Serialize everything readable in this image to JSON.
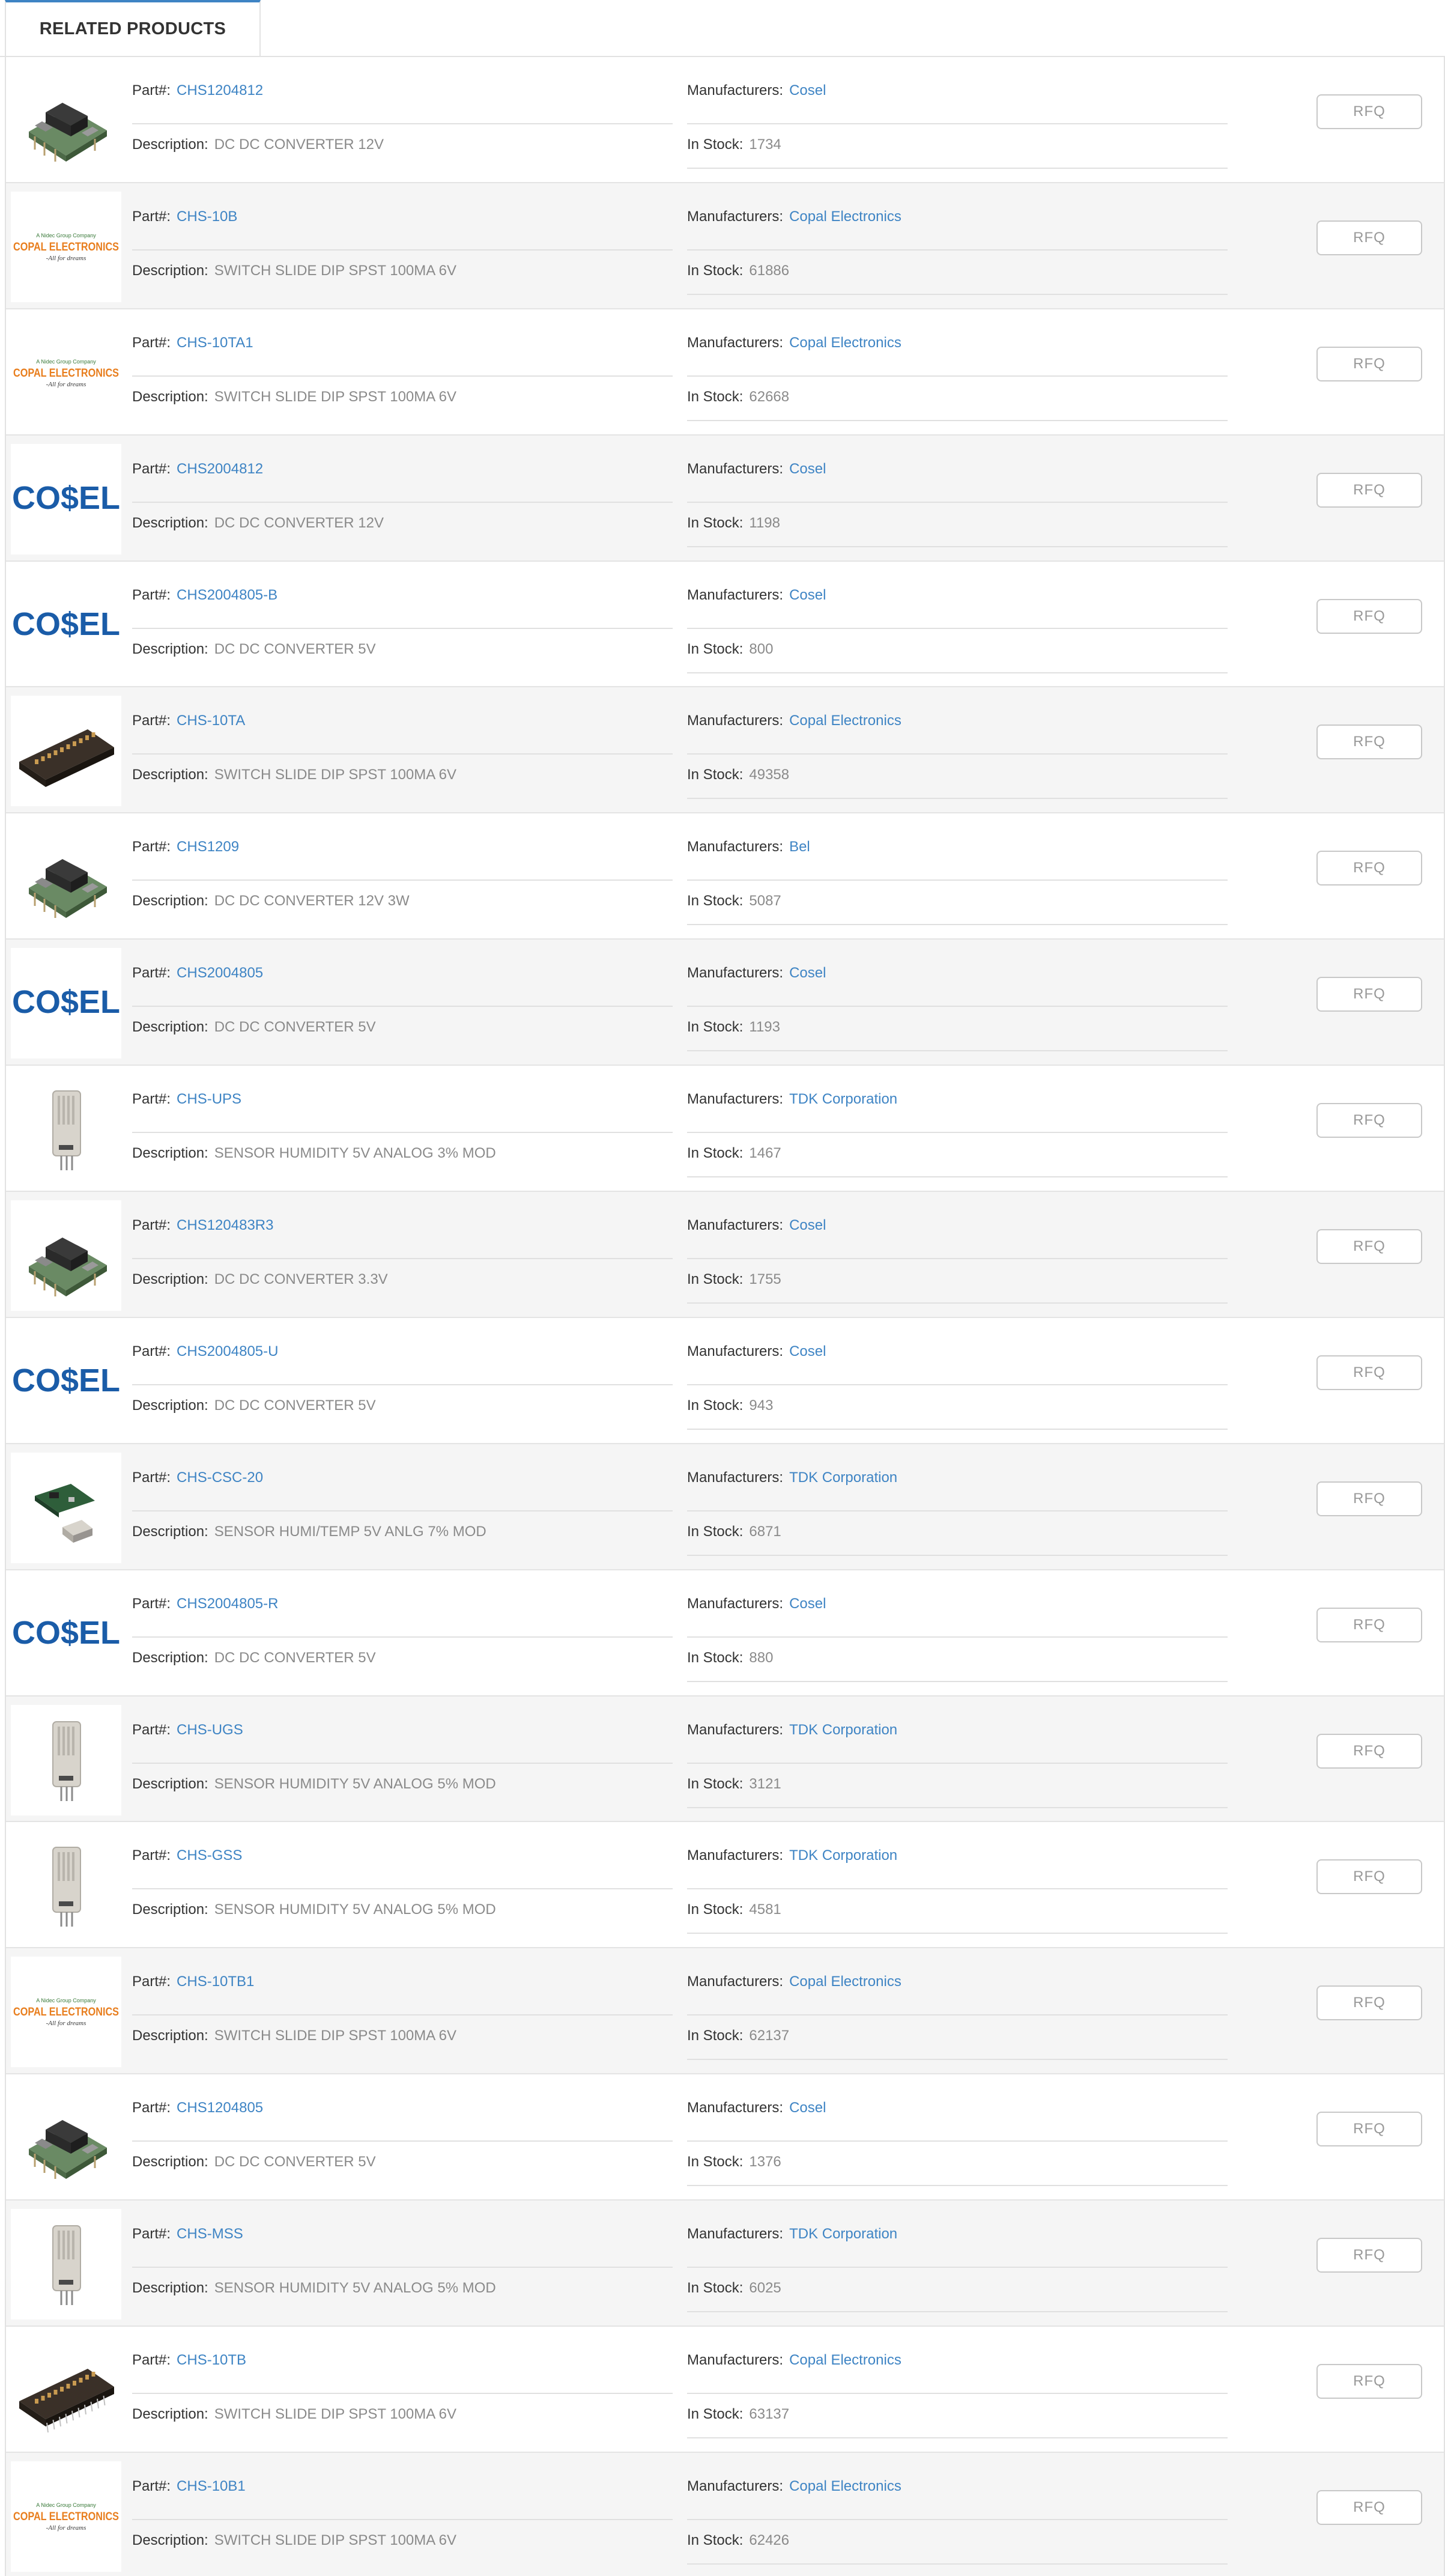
{
  "tab": {
    "label": "RELATED PRODUCTS"
  },
  "labels": {
    "part": "Part#:",
    "description": "Description:",
    "manufacturers": "Manufacturers:",
    "in_stock": "In Stock:",
    "rfq": "RFQ"
  },
  "colors": {
    "link": "#3e84c4",
    "tab_accent": "#3e84c4",
    "alt_row": "#f5f5f5"
  },
  "products": [
    {
      "part": "CHS1204812",
      "description": "DC DC CONVERTER 12V",
      "manufacturer": "Cosel",
      "stock": "1734",
      "image": "power-module"
    },
    {
      "part": "CHS-10B",
      "description": "SWITCH SLIDE DIP SPST 100MA 6V",
      "manufacturer": "Copal Electronics",
      "stock": "61886",
      "image": "copal-logo",
      "logo_text": {
        "top": "A Nidec Group Company",
        "main": "COPAL ELECTRONICS",
        "tagline": "-All for dreams"
      }
    },
    {
      "part": "CHS-10TA1",
      "description": "SWITCH SLIDE DIP SPST 100MA 6V",
      "manufacturer": "Copal Electronics",
      "stock": "62668",
      "image": "copal-logo",
      "logo_text": {
        "top": "A Nidec Group Company",
        "main": "COPAL ELECTRONICS",
        "tagline": "-All for dreams"
      }
    },
    {
      "part": "CHS2004812",
      "description": "DC DC CONVERTER 12V",
      "manufacturer": "Cosel",
      "stock": "1198",
      "image": "cosel-logo",
      "logo_text": {
        "main": "CO$EL"
      }
    },
    {
      "part": "CHS2004805-B",
      "description": "DC DC CONVERTER 5V",
      "manufacturer": "Cosel",
      "stock": "800",
      "image": "cosel-logo",
      "logo_text": {
        "main": "CO$EL"
      }
    },
    {
      "part": "CHS-10TA",
      "description": "SWITCH SLIDE DIP SPST 100MA 6V",
      "manufacturer": "Copal Electronics",
      "stock": "49358",
      "image": "dip-switch"
    },
    {
      "part": "CHS1209",
      "description": "DC DC CONVERTER 12V 3W",
      "manufacturer": "Bel",
      "stock": "5087",
      "image": "power-module"
    },
    {
      "part": "CHS2004805",
      "description": "DC DC CONVERTER 5V",
      "manufacturer": "Cosel",
      "stock": "1193",
      "image": "cosel-logo",
      "logo_text": {
        "main": "CO$EL"
      }
    },
    {
      "part": "CHS-UPS",
      "description": "SENSOR HUMIDITY 5V ANALOG 3% MOD",
      "manufacturer": "TDK Corporation",
      "stock": "1467",
      "image": "humidity-sensor"
    },
    {
      "part": "CHS120483R3",
      "description": "DC DC CONVERTER 3.3V",
      "manufacturer": "Cosel",
      "stock": "1755",
      "image": "power-module"
    },
    {
      "part": "CHS2004805-U",
      "description": "DC DC CONVERTER 5V",
      "manufacturer": "Cosel",
      "stock": "943",
      "image": "cosel-logo",
      "logo_text": {
        "main": "CO$EL"
      }
    },
    {
      "part": "CHS-CSC-20",
      "description": "SENSOR HUMI/TEMP 5V ANLG 7% MOD",
      "manufacturer": "TDK Corporation",
      "stock": "6871",
      "image": "sensor-module"
    },
    {
      "part": "CHS2004805-R",
      "description": "DC DC CONVERTER 5V",
      "manufacturer": "Cosel",
      "stock": "880",
      "image": "cosel-logo",
      "logo_text": {
        "main": "CO$EL"
      }
    },
    {
      "part": "CHS-UGS",
      "description": "SENSOR HUMIDITY 5V ANALOG 5% MOD",
      "manufacturer": "TDK Corporation",
      "stock": "3121",
      "image": "humidity-sensor"
    },
    {
      "part": "CHS-GSS",
      "description": "SENSOR HUMIDITY 5V ANALOG 5% MOD",
      "manufacturer": "TDK Corporation",
      "stock": "4581",
      "image": "humidity-sensor"
    },
    {
      "part": "CHS-10TB1",
      "description": "SWITCH SLIDE DIP SPST 100MA 6V",
      "manufacturer": "Copal Electronics",
      "stock": "62137",
      "image": "copal-logo",
      "logo_text": {
        "top": "A Nidec Group Company",
        "main": "COPAL ELECTRONICS",
        "tagline": "-All for dreams"
      }
    },
    {
      "part": "CHS1204805",
      "description": "DC DC CONVERTER 5V",
      "manufacturer": "Cosel",
      "stock": "1376",
      "image": "power-module"
    },
    {
      "part": "CHS-MSS",
      "description": "SENSOR HUMIDITY 5V ANALOG 5% MOD",
      "manufacturer": "TDK Corporation",
      "stock": "6025",
      "image": "humidity-sensor"
    },
    {
      "part": "CHS-10TB",
      "description": "SWITCH SLIDE DIP SPST 100MA 6V",
      "manufacturer": "Copal Electronics",
      "stock": "63137",
      "image": "dip-switch-pins"
    },
    {
      "part": "CHS-10B1",
      "description": "SWITCH SLIDE DIP SPST 100MA 6V",
      "manufacturer": "Copal Electronics",
      "stock": "62426",
      "image": "copal-logo",
      "logo_text": {
        "top": "A Nidec Group Company",
        "main": "COPAL ELECTRONICS",
        "tagline": "-All for dreams"
      }
    }
  ]
}
